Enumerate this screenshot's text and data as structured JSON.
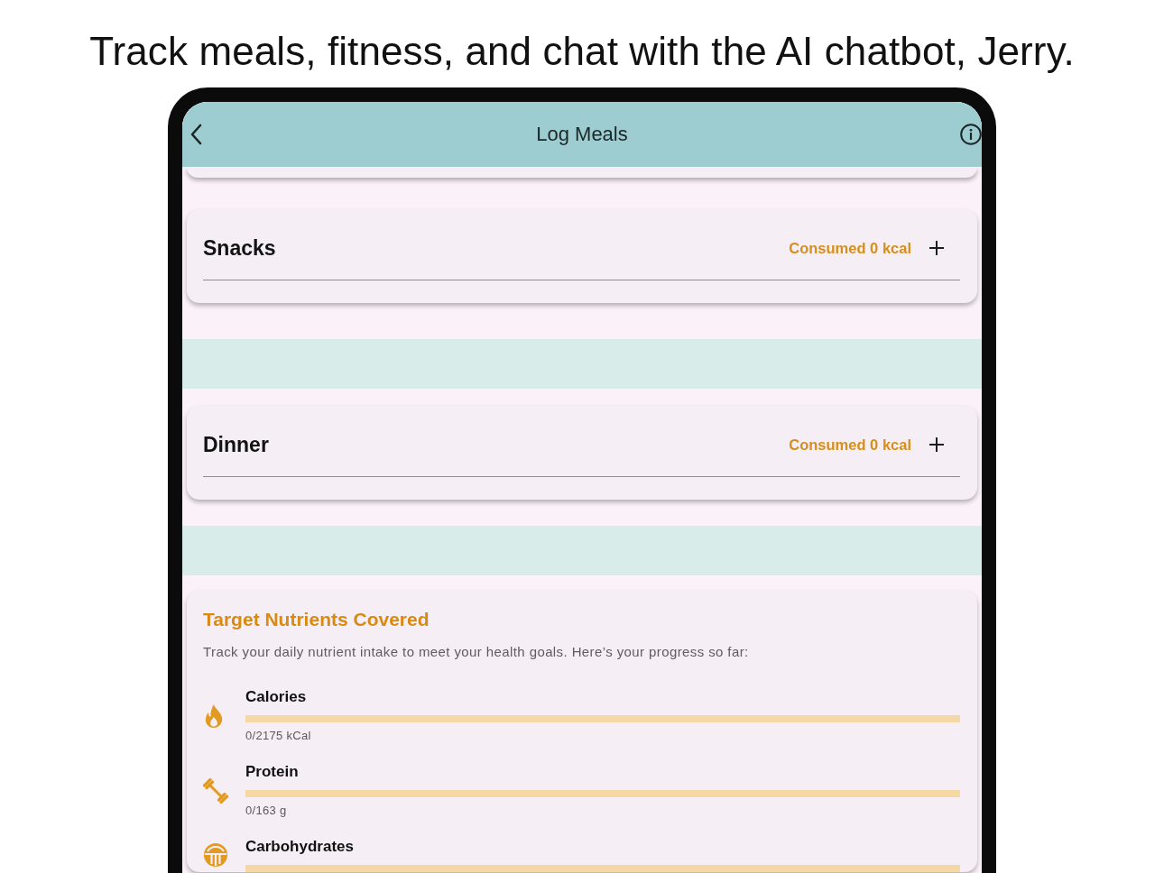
{
  "headline": "Track meals, fitness, and chat with the AI chatbot, Jerry.",
  "app_bar": {
    "title": "Log Meals"
  },
  "meals": [
    {
      "name": "Snacks",
      "consumed": "Consumed 0 kcal"
    },
    {
      "name": "Dinner",
      "consumed": "Consumed 0 kcal"
    }
  ],
  "nutrients": {
    "title": "Target Nutrients Covered",
    "description": "Track your daily nutrient intake to meet your health goals. Here’s your progress so far:",
    "items": [
      {
        "kind": "calories",
        "name": "Calories",
        "level": 0,
        "reading": "0/2175 kCal"
      },
      {
        "kind": "protein",
        "name": "Protein",
        "level": 0,
        "reading": "0/163 g"
      },
      {
        "kind": "carbohydrates",
        "name": "Carbohydrates",
        "level": 0
      }
    ]
  }
}
